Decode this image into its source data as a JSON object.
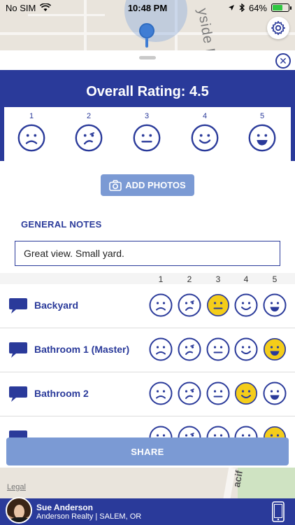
{
  "status_bar": {
    "carrier": "No SIM",
    "time": "10:48 PM",
    "battery": "64%",
    "battery_level": 0.64
  },
  "map": {
    "street_top": "yside R",
    "street_bottom": "acif",
    "legal": "Legal"
  },
  "rating": {
    "title": "Overall Rating: 4.5",
    "options": [
      {
        "num": "1",
        "face": "sad"
      },
      {
        "num": "2",
        "face": "confused"
      },
      {
        "num": "3",
        "face": "neutral"
      },
      {
        "num": "4",
        "face": "smile"
      },
      {
        "num": "5",
        "face": "grin"
      }
    ]
  },
  "add_photos_label": "ADD PHOTOS",
  "general_notes": {
    "label": "GENERAL NOTES",
    "value": "Great view. Small yard."
  },
  "grid": {
    "columns": [
      "1",
      "2",
      "3",
      "4",
      "5"
    ],
    "rows": [
      {
        "room": "Backyard",
        "selected": 3
      },
      {
        "room": "Bathroom 1 (Master)",
        "selected": 5
      },
      {
        "room": "Bathroom 2",
        "selected": 4
      },
      {
        "room": "",
        "selected": 5
      }
    ]
  },
  "share_label": "SHARE",
  "agent": {
    "name": "Sue Anderson",
    "company": "Anderson Realty | SALEM, OR"
  },
  "colors": {
    "brand": "#2a3a9a",
    "button": "#7b9ad4",
    "selected_face": "#f4cd1a"
  }
}
